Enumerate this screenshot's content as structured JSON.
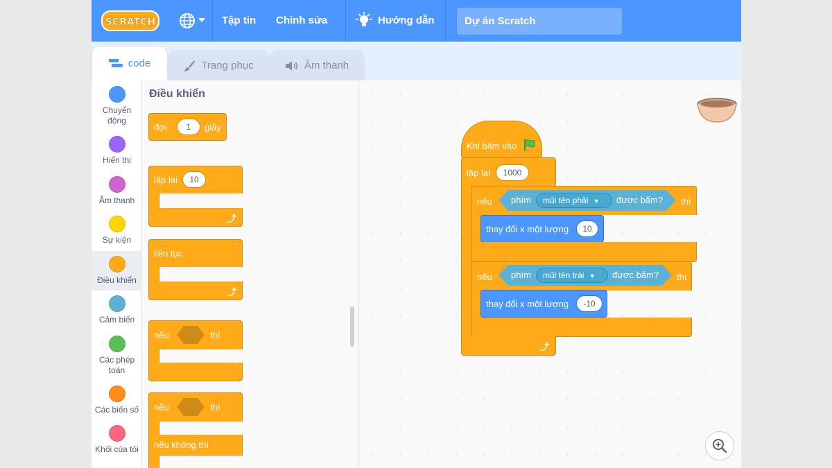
{
  "menubar": {
    "logo_text": "SCRATCH",
    "file": "Tập tin",
    "edit": "Chỉnh sửa",
    "tutorials": "Hướng dẫn",
    "project_title": "Dự án Scratch"
  },
  "tabs": {
    "code": "code",
    "costumes": "Trang phục",
    "sounds": "Âm thanh"
  },
  "categories": [
    {
      "label1": "Chuyển",
      "label2": "động",
      "color": "#4c97ff"
    },
    {
      "label1": "Hiển thị",
      "label2": "",
      "color": "#9966ff"
    },
    {
      "label1": "Âm thanh",
      "label2": "",
      "color": "#cf63cf"
    },
    {
      "label1": "Sự kiện",
      "label2": "",
      "color": "#ffd500"
    },
    {
      "label1": "Điều khiển",
      "label2": "",
      "color": "#ffab19"
    },
    {
      "label1": "Cảm biến",
      "label2": "",
      "color": "#5cb1d6"
    },
    {
      "label1": "Các phép",
      "label2": "toán",
      "color": "#59c059"
    },
    {
      "label1": "Các biến số",
      "label2": "",
      "color": "#ff8c1a"
    },
    {
      "label1": "Khối của tôi",
      "label2": "",
      "color": "#ff6680"
    }
  ],
  "palette": {
    "title": "Điều khiển",
    "wait": {
      "label": "đợi",
      "value": "1",
      "unit": "giây"
    },
    "repeat": {
      "label": "lặp lại",
      "value": "10"
    },
    "forever": {
      "label": "liên tục"
    },
    "if_then": {
      "if": "nếu",
      "then": "thì"
    },
    "if_else": {
      "if": "nếu",
      "then": "thì",
      "else": "nếu không thì"
    }
  },
  "script": {
    "hat": "Khi bấm vào",
    "repeat": {
      "label": "lặp lại",
      "value": "1000"
    },
    "if1": {
      "if": "nếu",
      "then": "thì",
      "key_label": "phím",
      "key": "mũi tên phải",
      "pressed": "được bấm?",
      "action": "thay đổi x một lượng",
      "value": "10"
    },
    "if2": {
      "if": "nếu",
      "then": "thì",
      "key_label": "phím",
      "key": "mũi tên trái",
      "pressed": "được bấm?",
      "action": "thay đổi x một lượng",
      "value": "-10"
    }
  },
  "colors": {
    "menubar": "#4c97ff",
    "control": "#ffab19",
    "sensing": "#5cb1d6",
    "motion": "#4c97ff"
  }
}
